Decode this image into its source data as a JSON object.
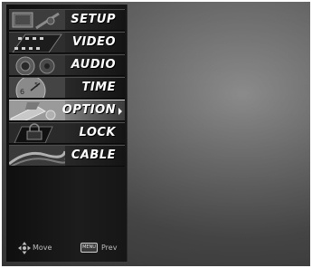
{
  "menu": {
    "items": [
      {
        "label": "SETUP",
        "icon": "setup-icon"
      },
      {
        "label": "VIDEO",
        "icon": "video-icon"
      },
      {
        "label": "AUDIO",
        "icon": "audio-icon"
      },
      {
        "label": "TIME",
        "icon": "time-icon"
      },
      {
        "label": "OPTION",
        "icon": "option-icon",
        "selected": true
      },
      {
        "label": "LOCK",
        "icon": "lock-icon"
      },
      {
        "label": "CABLE",
        "icon": "cable-icon"
      }
    ]
  },
  "nav_hint": {
    "move_label": "Move",
    "menu_key_label": "MENU",
    "prev_label": "Prev"
  },
  "colors": {
    "panel": "#161616",
    "selected": "#9a9a9a",
    "label": "#ffffff",
    "screen": "#6a6a6a"
  }
}
